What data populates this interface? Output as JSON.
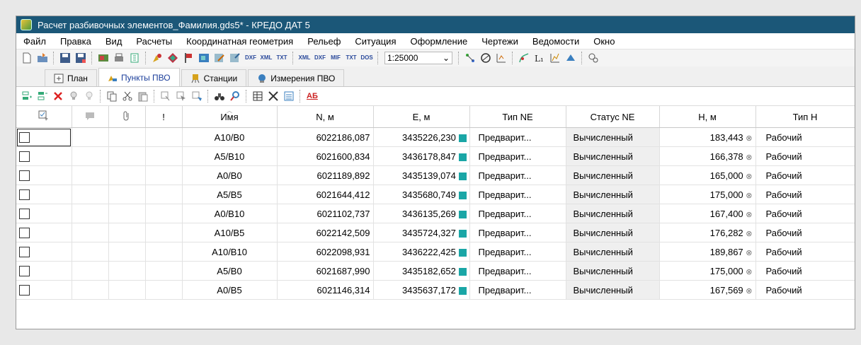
{
  "window": {
    "title": "Расчет разбивочных элементов_Фамилия.gds5* - КРЕДО ДАТ 5"
  },
  "menu": [
    "Файл",
    "Правка",
    "Вид",
    "Расчеты",
    "Координатная геометрия",
    "Рельеф",
    "Ситуация",
    "Оформление",
    "Чертежи",
    "Ведомости",
    "Окно"
  ],
  "toolbar": {
    "scale": "1:25000",
    "labels": [
      "DXF",
      "XML",
      "TXT",
      "XML",
      "DXF",
      "MIF",
      "TXT",
      "DOS"
    ]
  },
  "tabs": [
    "План",
    "Пункты ПВО",
    "Станции",
    "Измерения ПВО"
  ],
  "subtoolbar": {
    "ab_label": "АБ"
  },
  "table": {
    "headers": [
      "",
      "",
      "",
      "!",
      "Имя",
      "N, м",
      "E, м",
      "Тип NE",
      "Статус NE",
      "H, м",
      "Тип H"
    ],
    "rows": [
      {
        "name": "A10/B0",
        "n": "6022186,087",
        "e": "3435226,230",
        "type_ne": "Предварит...",
        "status_ne": "Вычисленный",
        "h": "183,443",
        "type_h": "Рабочий"
      },
      {
        "name": "A5/B10",
        "n": "6021600,834",
        "e": "3436178,847",
        "type_ne": "Предварит...",
        "status_ne": "Вычисленный",
        "h": "166,378",
        "type_h": "Рабочий"
      },
      {
        "name": "A0/B0",
        "n": "6021189,892",
        "e": "3435139,074",
        "type_ne": "Предварит...",
        "status_ne": "Вычисленный",
        "h": "165,000",
        "type_h": "Рабочий"
      },
      {
        "name": "A5/B5",
        "n": "6021644,412",
        "e": "3435680,749",
        "type_ne": "Предварит...",
        "status_ne": "Вычисленный",
        "h": "175,000",
        "type_h": "Рабочий"
      },
      {
        "name": "A0/B10",
        "n": "6021102,737",
        "e": "3436135,269",
        "type_ne": "Предварит...",
        "status_ne": "Вычисленный",
        "h": "167,400",
        "type_h": "Рабочий"
      },
      {
        "name": "A10/B5",
        "n": "6022142,509",
        "e": "3435724,327",
        "type_ne": "Предварит...",
        "status_ne": "Вычисленный",
        "h": "176,282",
        "type_h": "Рабочий"
      },
      {
        "name": "A10/B10",
        "n": "6022098,931",
        "e": "3436222,425",
        "type_ne": "Предварит...",
        "status_ne": "Вычисленный",
        "h": "189,867",
        "type_h": "Рабочий"
      },
      {
        "name": "A5/B0",
        "n": "6021687,990",
        "e": "3435182,652",
        "type_ne": "Предварит...",
        "status_ne": "Вычисленный",
        "h": "175,000",
        "type_h": "Рабочий"
      },
      {
        "name": "A0/B5",
        "n": "6021146,314",
        "e": "3435637,172",
        "type_ne": "Предварит...",
        "status_ne": "Вычисленный",
        "h": "167,569",
        "type_h": "Рабочий"
      }
    ]
  },
  "colors": {
    "titlebar": "#1b5778",
    "type_ne_marker": "#1aa6a6"
  }
}
